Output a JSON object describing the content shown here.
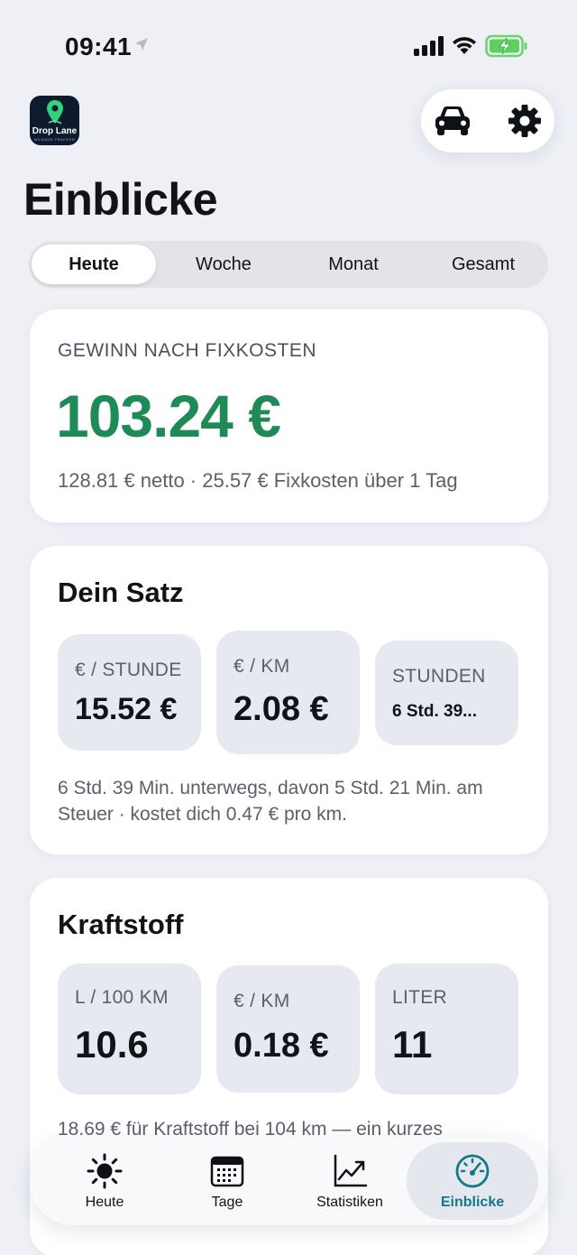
{
  "status_bar": {
    "time": "09:41"
  },
  "app": {
    "logo_text": "Drop Lane",
    "logo_subtext": "MILEAGE TRACKER"
  },
  "header": {
    "title": "Einblicke"
  },
  "periods": {
    "tabs": [
      "Heute",
      "Woche",
      "Monat",
      "Gesamt"
    ],
    "selected": "Heute"
  },
  "profit": {
    "label": "GEWINN NACH FIXKOSTEN",
    "value": "103.24 €",
    "subtitle": "128.81 € netto · 25.57 € Fixkosten über 1 Tag",
    "color": "#1e8a55"
  },
  "rate": {
    "title": "Dein Satz",
    "tiles": [
      {
        "label": "€ / STUNDE",
        "value": "15.52 €"
      },
      {
        "label": "€ / KM",
        "value": "2.08 €"
      },
      {
        "label": "STUNDEN",
        "value": "6 Std. 39..."
      }
    ],
    "note": "6 Std. 39 Min. unterwegs, davon 5 Std. 21 Min. am Steuer · kostet dich 0.47 € pro km."
  },
  "fuel": {
    "title": "Kraftstoff",
    "tiles": [
      {
        "label": "L / 100 KM",
        "value": "10.6"
      },
      {
        "label": "€ / KM",
        "value": "0.18 €"
      },
      {
        "label": "LITER",
        "value": "11"
      }
    ],
    "note": "18.69 € für Kraftstoff bei 104 km — ein kurzes"
  },
  "tab_bar": {
    "items": [
      {
        "label": "Heute",
        "icon": "sun-icon"
      },
      {
        "label": "Tage",
        "icon": "calendar-icon"
      },
      {
        "label": "Statistiken",
        "icon": "chart-icon"
      },
      {
        "label": "Einblicke",
        "icon": "speedometer-icon"
      }
    ],
    "active": "Einblicke",
    "accent": "#127a86"
  }
}
